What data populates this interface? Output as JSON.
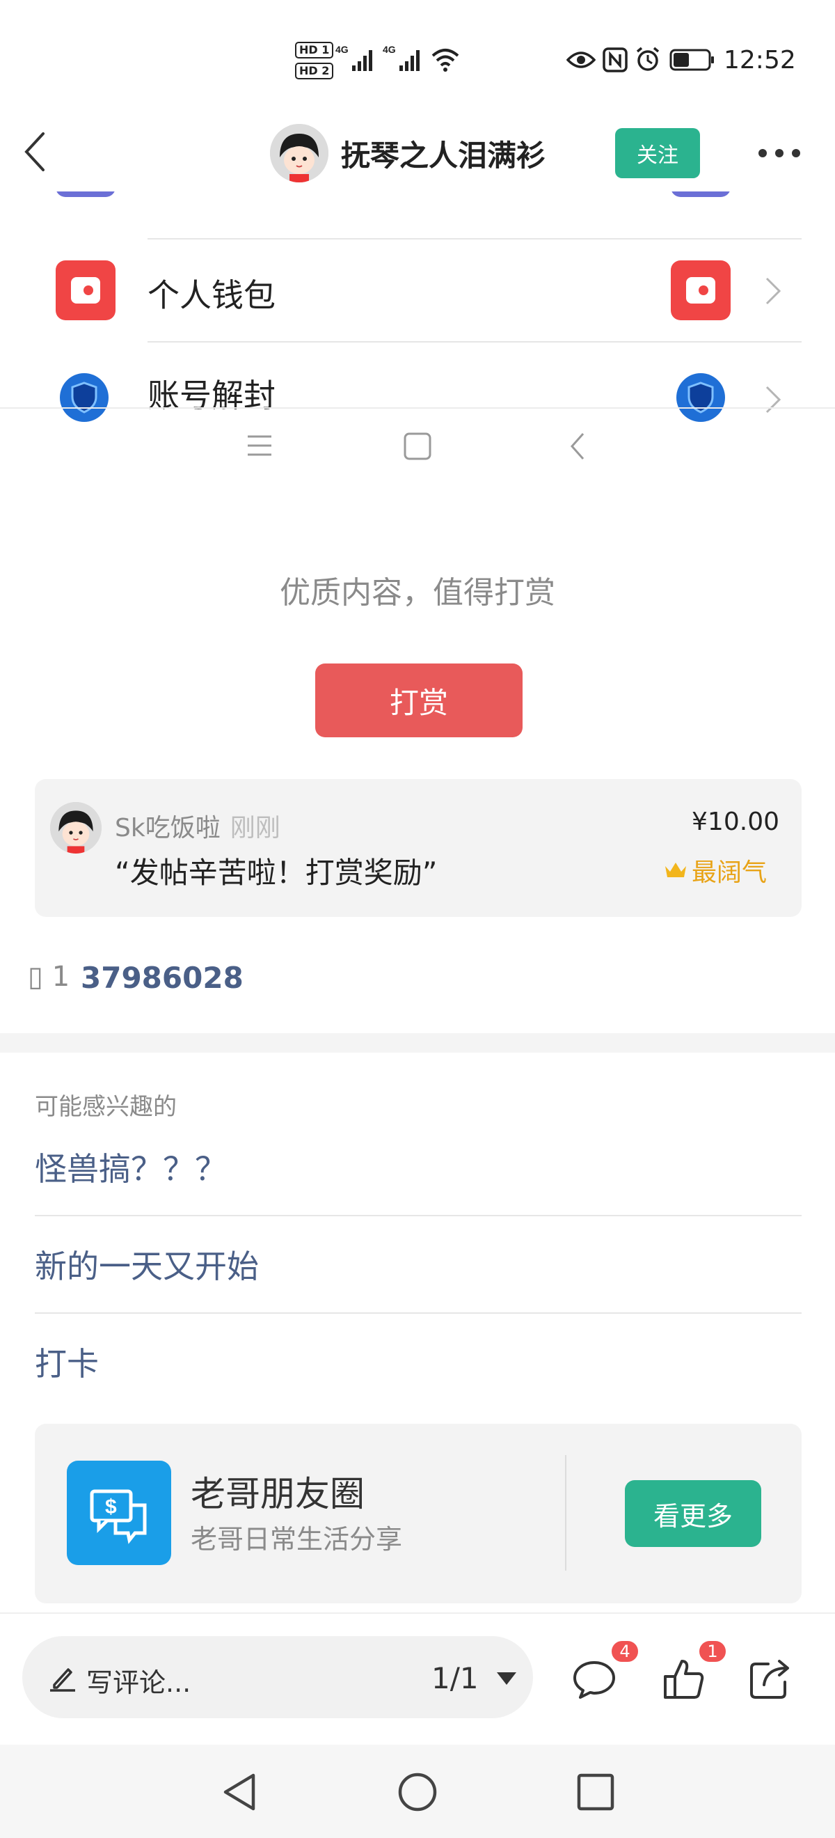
{
  "status_bar": {
    "time": "12:52",
    "sim1": "HD 1",
    "sim2": "HD 2",
    "network1": "4G",
    "network2": "4G"
  },
  "header": {
    "title": "抚琴之人泪满衫",
    "follow_label": "关注"
  },
  "embedded_screenshot": {
    "items": [
      {
        "label": "个人钱包",
        "icon": "wallet-icon"
      },
      {
        "label": "账号解封",
        "icon": "shield-icon"
      }
    ]
  },
  "reward": {
    "prompt": "优质内容，值得打赏",
    "button_label": "打赏",
    "tip": {
      "user": "Sk吃饭啦",
      "time": "刚刚",
      "message": "“发帖辛苦啦！打赏奖励”",
      "amount": "¥10.00",
      "badge": "最阔气"
    },
    "count_prefix": "▯ 1",
    "id_number": "37986028"
  },
  "related": {
    "title": "可能感兴趣的",
    "items": [
      "怪兽搞？？？",
      "新的一天又开始",
      "打卡"
    ]
  },
  "promo": {
    "title": "老哥朋友圈",
    "subtitle": "老哥日常生活分享",
    "button_label": "看更多"
  },
  "bottom_bar": {
    "comment_placeholder": "写评论...",
    "page_indicator": "1/1",
    "comment_count": "4",
    "like_count": "1"
  },
  "colors": {
    "accent_green": "#2bb38f",
    "reward_red": "#e85a5a",
    "link_blue": "#4a5f87",
    "gold": "#e8a317",
    "badge_red": "#f05252"
  }
}
